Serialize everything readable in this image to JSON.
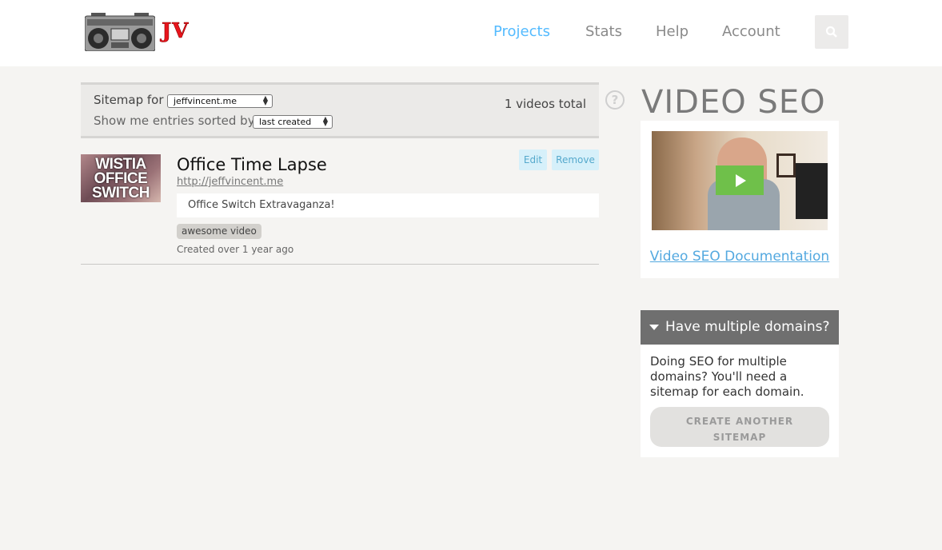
{
  "header": {
    "logo_icon": "boombox-logo-icon",
    "brand": "JV",
    "nav": [
      {
        "label": "Projects",
        "active": true
      },
      {
        "label": "Stats",
        "active": false
      },
      {
        "label": "Help",
        "active": false
      },
      {
        "label": "Account",
        "active": false
      }
    ],
    "search_icon": "search-icon",
    "accent_color": "#54bbff"
  },
  "sitemap": {
    "label_for": "Sitemap for",
    "domain_value": "jeffvincent.me",
    "label_sort": "Show me entries sorted by",
    "sort_value": "last created",
    "total_text": "1 videos total",
    "help_icon_text": "?"
  },
  "video": {
    "thumbnail_lines": [
      "WISTIA",
      "OFFICE",
      "SWITCH"
    ],
    "title": "Office Time Lapse",
    "url": "http://jeffvincent.me",
    "edit_label": "Edit",
    "remove_label": "Remove",
    "description": "Office Switch Extravaganza!",
    "tag": "awesome video",
    "created": "Created over 1 year ago"
  },
  "sidebar": {
    "title": "VIDEO SEO",
    "doc_link": "Video SEO Documentation",
    "play_icon": "play-icon",
    "domains_title": "Have multiple domains?",
    "domains_text": "Doing SEO for multiple domains? You'll need a sitemap for each domain.",
    "create_line1": "CREATE ANOTHER",
    "create_line2": "SITEMAP"
  }
}
